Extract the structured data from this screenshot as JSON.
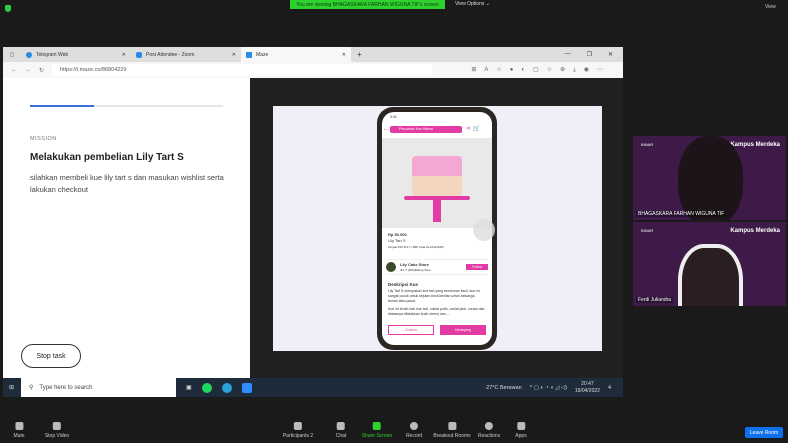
{
  "zoom": {
    "banner": "You are viewing BHAGASKARA FARHAN WIGUNA TIF's screen",
    "view_options": "View Options ⌄",
    "view": "View"
  },
  "browser": {
    "tabs": [
      {
        "label": "Telegram Web"
      },
      {
        "label": "Post Attendee - Zoom"
      },
      {
        "label": "Maze"
      }
    ],
    "url": "https://t.maze.co/86804229"
  },
  "maze": {
    "mission_label": "MISSION",
    "title": "Melakukan pembelian Lily Tart S",
    "description": "silahkan membeli kue lily tart s dan masukan wishlist serta lakukan checkout",
    "stop_task": "Stop task",
    "progress": 0.33
  },
  "app": {
    "time": "9:41",
    "search_placeholder": "Pencarian Kue Hitmat",
    "price": "Rp 50.000",
    "product": "Lily Tart S",
    "meta": "Terjual 150  ★4.7 (180)  Kata Pembeli(180)",
    "store": "Lily Cake Store",
    "store_meta": "★4.7 (250)Rating Toko",
    "follow": "Follow",
    "desc_title": "Deskripsi Kue",
    "desc1": "Lily Tart S merupakan kue tart yang berukuran kecil, kue ini sangat cocok untuk kejutan kecil-kecilan untuk keluarga, teman atau pacar.",
    "desc2": "Kue ini terdiri dari kue tart, coklat putih, coklat pink, cream dan diatasnya diletakkan buah cherry dan....",
    "custom": "Custom",
    "cart": "Keranjang"
  },
  "taskbar": {
    "search": "Type here to search",
    "weather": "27°C  Berawan",
    "time": "20:47",
    "date": "19/04/2022",
    "notif": "4"
  },
  "participants": [
    {
      "name": "BHAGASKARA FARHAN WIGUNA TIF",
      "logo": "BINAR",
      "brand": "Kampus Merdeka"
    },
    {
      "name": "Ferdi Juliandra",
      "logo": "BINAR",
      "brand": "Kampus Merdeka"
    }
  ],
  "toolbar": {
    "mute": "Mute",
    "stop_video": "Stop Video",
    "participants": "Participants",
    "participant_count": "2",
    "chat": "Chat",
    "share": "Share Screen",
    "record": "Record",
    "breakout": "Breakout Rooms",
    "reactions": "Reactions",
    "apps": "Apps",
    "leave": "Leave Room"
  }
}
